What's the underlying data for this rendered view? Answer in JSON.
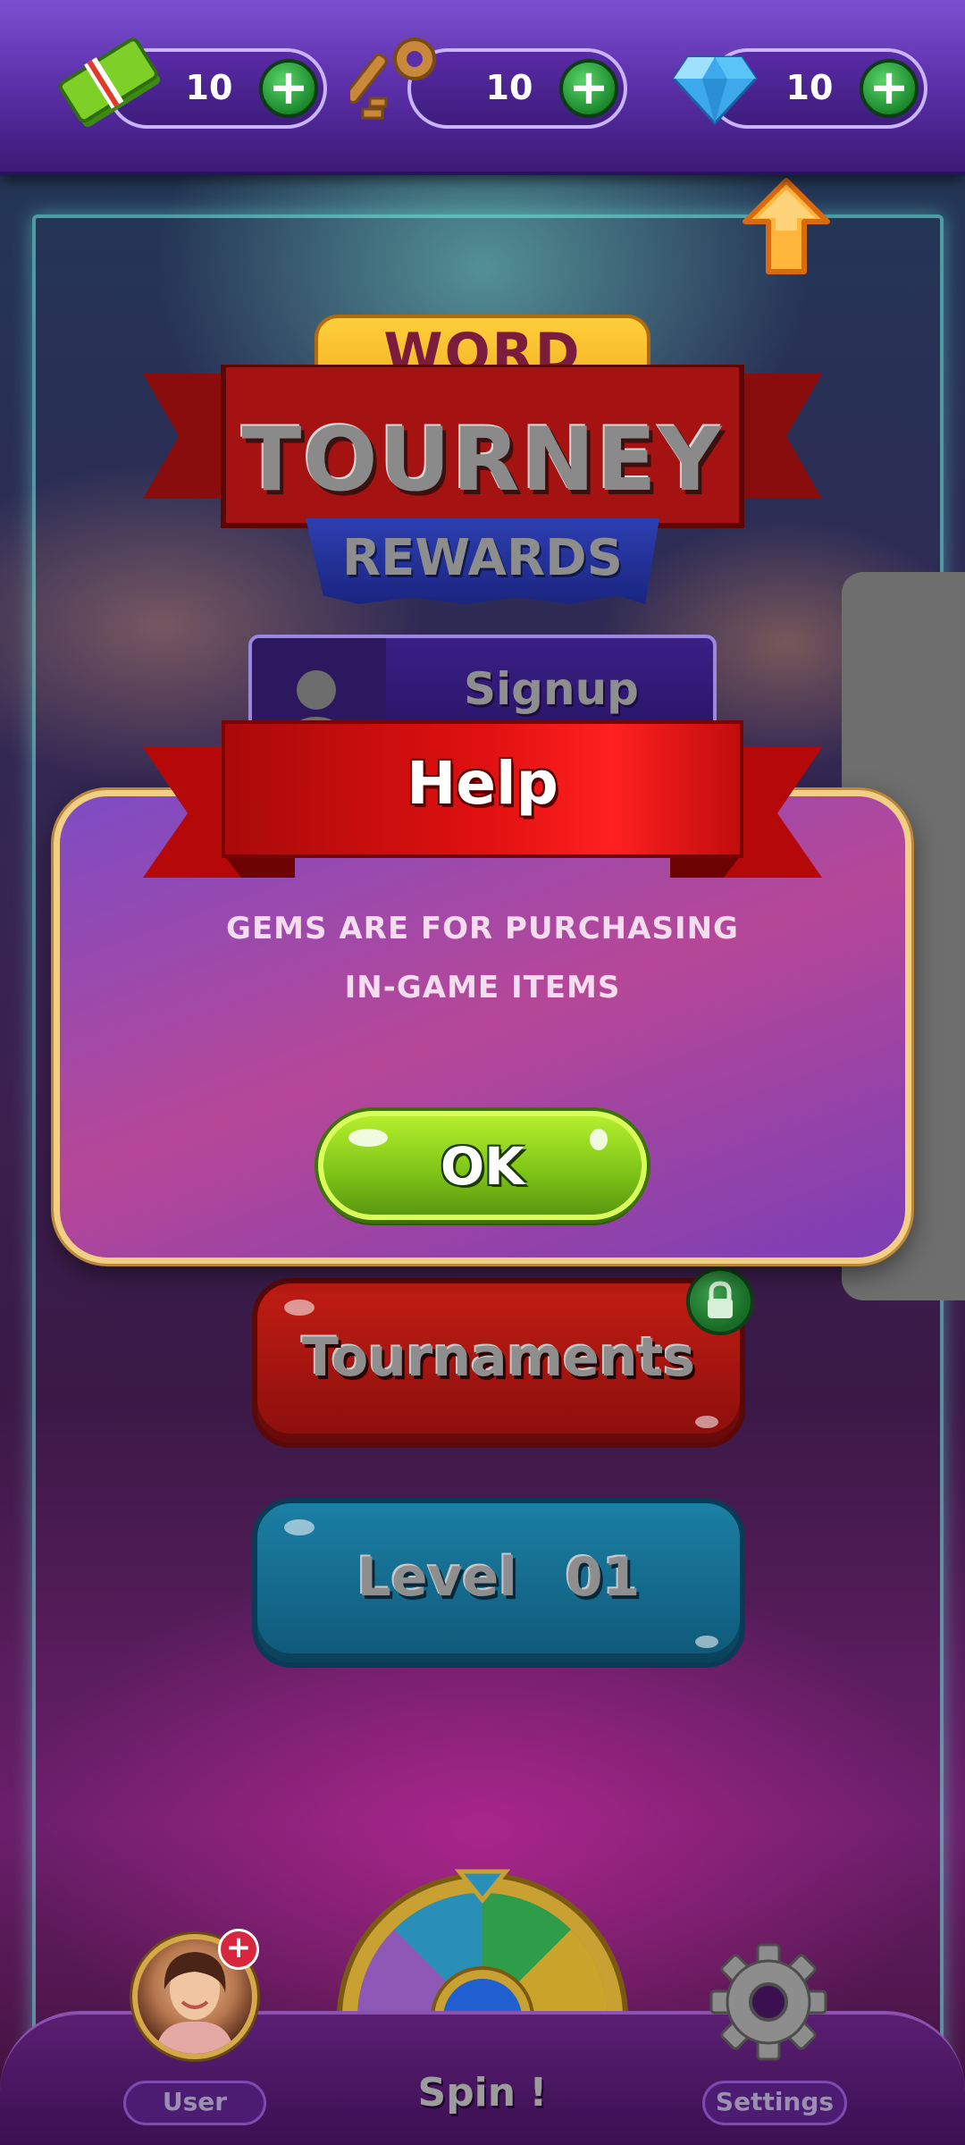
{
  "currency": {
    "cash": {
      "icon": "cash-bundle-icon",
      "value": "10"
    },
    "keys": {
      "icon": "key-icon",
      "value": "10"
    },
    "gems": {
      "icon": "diamond-gem-icon",
      "value": "10"
    },
    "add_symbol": "+"
  },
  "title": {
    "line1": "WORD",
    "line2": "TOURNEY",
    "line3": "REWARDS"
  },
  "menu": {
    "signup_label": "Signup",
    "tournaments_label": "Tournaments",
    "level_label": "Level",
    "level_number": "01"
  },
  "help_dialog": {
    "title": "Help",
    "message_line1": "GEMS ARE FOR PURCHASING",
    "message_line2": "IN-GAME ITEMS",
    "ok_label": "OK"
  },
  "bottom_nav": {
    "user_label": "User",
    "spin_label": "Spin !",
    "settings_label": "Settings",
    "avatar_add_symbol": "+"
  },
  "colors": {
    "top_bar": "#5b2fa8",
    "help_ribbon": "#d40d0d",
    "ok_button": "#8ccf1c",
    "tournaments_button": "#b0160f",
    "level_button": "#1470a0",
    "dialog_border": "#f3cf86"
  }
}
